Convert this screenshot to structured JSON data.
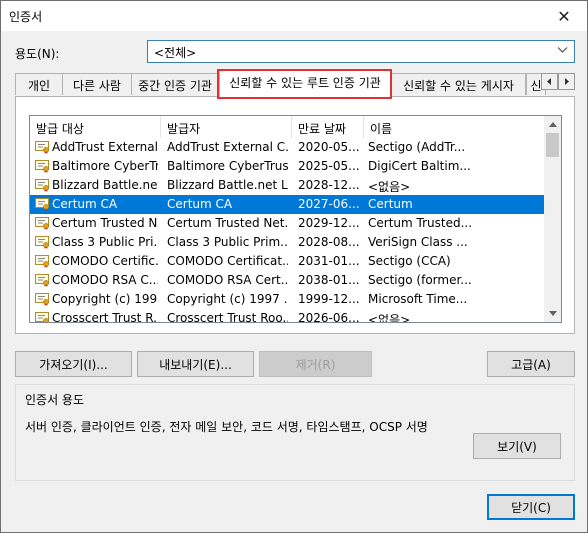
{
  "window": {
    "title": "인증서",
    "close_glyph": "✕"
  },
  "purpose": {
    "label": "용도(N):",
    "selected": "<전체>"
  },
  "tabs": [
    {
      "label": "개인"
    },
    {
      "label": "다른 사람"
    },
    {
      "label": "중간 인증 기관"
    },
    {
      "label": "신뢰할 수 있는 루트 인증 기관",
      "active": true
    },
    {
      "label": "신뢰할 수 있는 게시자"
    },
    {
      "label": "신"
    }
  ],
  "list": {
    "columns": [
      "발급 대상",
      "발급자",
      "만료 날짜",
      "이름"
    ],
    "rows": [
      {
        "issued_to": "AddTrust External...",
        "issued_by": "AddTrust External C...",
        "expires": "2020-05...",
        "name": "Sectigo (AddTr..."
      },
      {
        "issued_to": "Baltimore CyberTr...",
        "issued_by": "Baltimore CyberTrus...",
        "expires": "2025-05...",
        "name": "DigiCert Baltim..."
      },
      {
        "issued_to": "Blizzard Battle.net...",
        "issued_by": "Blizzard Battle.net L...",
        "expires": "2028-12...",
        "name": "<없음>"
      },
      {
        "issued_to": "Certum CA",
        "issued_by": "Certum CA",
        "expires": "2027-06...",
        "name": "Certum",
        "selected": true
      },
      {
        "issued_to": "Certum Trusted N...",
        "issued_by": "Certum Trusted Net...",
        "expires": "2029-12...",
        "name": "Certum Trusted..."
      },
      {
        "issued_to": "Class 3 Public Pri...",
        "issued_by": "Class 3 Public Prim...",
        "expires": "2028-08...",
        "name": "VeriSign Class ..."
      },
      {
        "issued_to": "COMODO Certific...",
        "issued_by": "COMODO Certificat...",
        "expires": "2031-01...",
        "name": "Sectigo (CCA)"
      },
      {
        "issued_to": "COMODO RSA C...",
        "issued_by": "COMODO RSA Cert...",
        "expires": "2038-01...",
        "name": "Sectigo (former..."
      },
      {
        "issued_to": "Copyright (c) 199...",
        "issued_by": "Copyright (c) 1997 ...",
        "expires": "1999-12...",
        "name": "Microsoft Time..."
      },
      {
        "issued_to": "Crosscert Trust R...",
        "issued_by": "Crosscert Trust Roo...",
        "expires": "2026-06...",
        "name": "<없음>"
      }
    ]
  },
  "buttons": {
    "import": "가져오기(I)...",
    "export": "내보내기(E)...",
    "remove": "제거(R)",
    "advanced": "고급(A)",
    "view": "보기(V)",
    "close": "닫기(C)"
  },
  "purposes_group": {
    "title": "인증서 용도",
    "text": "서버 인증, 클라이언트 인증, 전자 메일 보안, 코드 서명, 타임스탬프, OCSP 서명"
  },
  "colors": {
    "selection": "#0078d7",
    "highlight_box": "#e03232",
    "focus_border": "#0078d7"
  },
  "icons": {
    "row_icon": "certificate-icon"
  }
}
